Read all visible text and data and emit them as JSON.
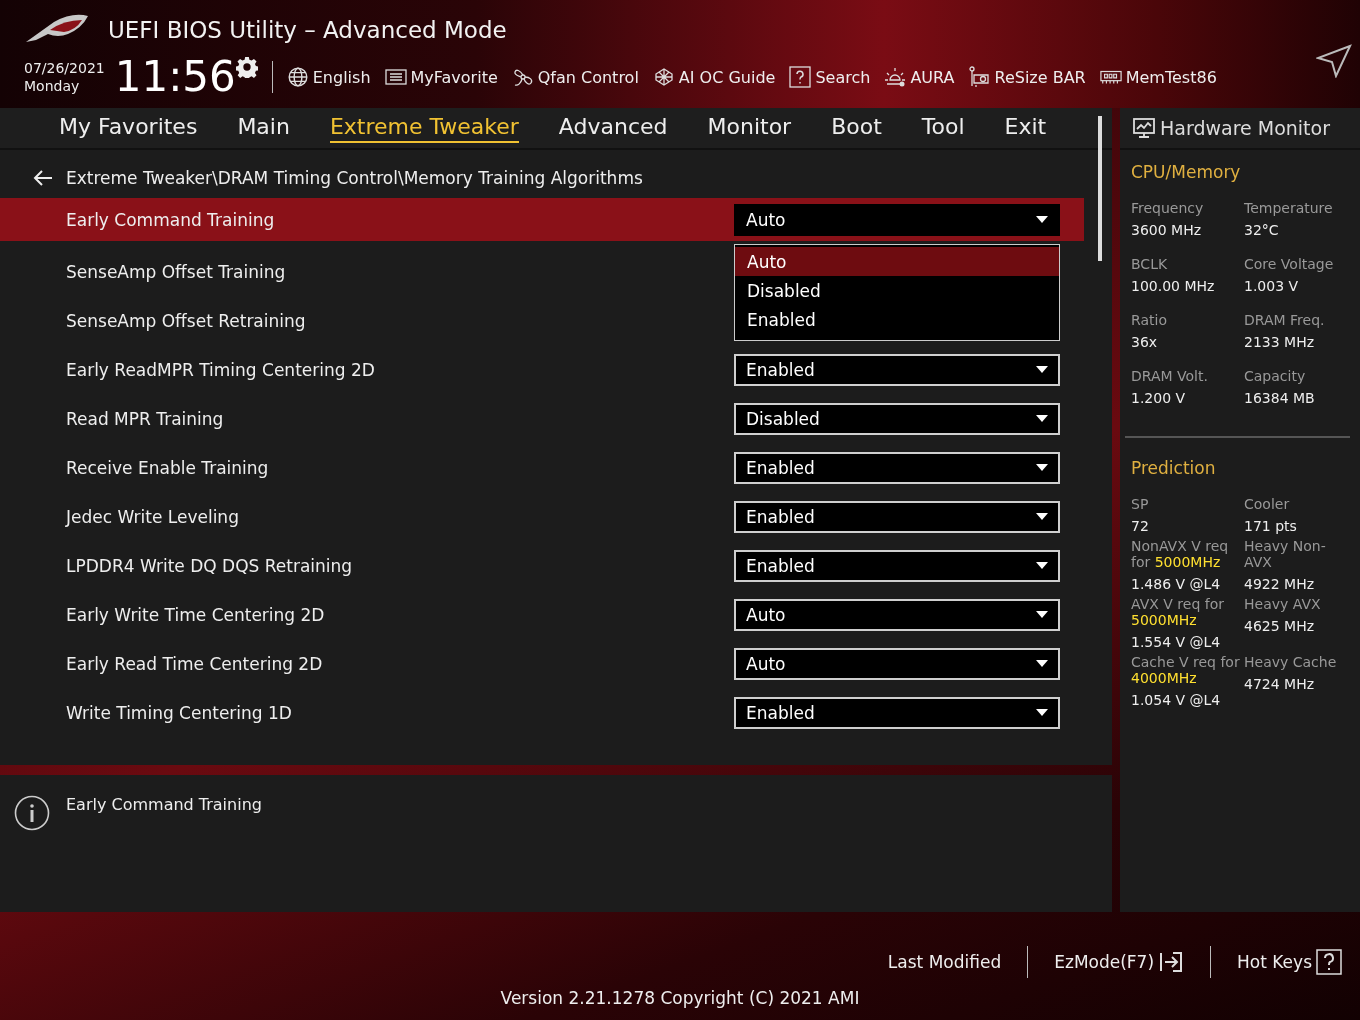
{
  "header": {
    "title": "UEFI BIOS Utility – Advanced Mode",
    "date": "07/26/2021",
    "day": "Monday",
    "time": "11:56",
    "tools": [
      {
        "label": "English"
      },
      {
        "label": "MyFavorite"
      },
      {
        "label": "Qfan Control"
      },
      {
        "label": "AI OC Guide"
      },
      {
        "label": "Search"
      },
      {
        "label": "AURA"
      },
      {
        "label": "ReSize BAR"
      },
      {
        "label": "MemTest86"
      }
    ]
  },
  "tabs": [
    {
      "label": "My Favorites",
      "selected": false
    },
    {
      "label": "Main",
      "selected": false
    },
    {
      "label": "Extreme Tweaker",
      "selected": true
    },
    {
      "label": "Advanced",
      "selected": false
    },
    {
      "label": "Monitor",
      "selected": false
    },
    {
      "label": "Boot",
      "selected": false
    },
    {
      "label": "Tool",
      "selected": false
    },
    {
      "label": "Exit",
      "selected": false
    }
  ],
  "breadcrumb": "Extreme Tweaker\\DRAM Timing Control\\Memory Training Algorithms",
  "settings": [
    {
      "label": "Early Command Training",
      "value": "Auto",
      "selected": true
    },
    {
      "label": "SenseAmp Offset Training",
      "selected": false
    },
    {
      "label": "SenseAmp Offset Retraining",
      "selected": false
    },
    {
      "label": "Early ReadMPR Timing Centering 2D",
      "value": "Enabled",
      "selected": false
    },
    {
      "label": "Read MPR Training",
      "value": "Disabled",
      "selected": false
    },
    {
      "label": "Receive Enable Training",
      "value": "Enabled",
      "selected": false
    },
    {
      "label": "Jedec Write Leveling",
      "value": "Enabled",
      "selected": false
    },
    {
      "label": "LPDDR4 Write DQ DQS Retraining",
      "value": "Enabled",
      "selected": false
    },
    {
      "label": "Early Write Time Centering 2D",
      "value": "Auto",
      "selected": false
    },
    {
      "label": "Early Read Time Centering 2D",
      "value": "Auto",
      "selected": false
    },
    {
      "label": "Write Timing Centering 1D",
      "value": "Enabled",
      "selected": false
    }
  ],
  "dropdown": {
    "options": [
      {
        "label": "Auto",
        "selected": true
      },
      {
        "label": "Disabled",
        "selected": false
      },
      {
        "label": "Enabled",
        "selected": false
      }
    ]
  },
  "help": {
    "text": "Early Command Training"
  },
  "hardware_monitor": {
    "title": "Hardware Monitor",
    "cpu_memory": {
      "title": "CPU/Memory",
      "items": [
        {
          "label": "Frequency",
          "value": "3600 MHz"
        },
        {
          "label": "Temperature",
          "value": "32°C"
        },
        {
          "label": "BCLK",
          "value": "100.00 MHz"
        },
        {
          "label": "Core Voltage",
          "value": "1.003 V"
        },
        {
          "label": "Ratio",
          "value": "36x"
        },
        {
          "label": "DRAM Freq.",
          "value": "2133 MHz"
        },
        {
          "label": "DRAM Volt.",
          "value": "1.200 V"
        },
        {
          "label": "Capacity",
          "value": "16384 MB"
        }
      ]
    },
    "prediction": {
      "title": "Prediction",
      "items": [
        {
          "label": "SP",
          "value": "72"
        },
        {
          "label": "Cooler",
          "value": "171 pts"
        },
        {
          "label": "NonAVX V req for",
          "highlight": "5000MHz",
          "value": "1.486 V @L4"
        },
        {
          "label": "Heavy Non-AVX",
          "value": "4922 MHz"
        },
        {
          "label": "AVX V req for",
          "highlight": "5000MHz",
          "value": "1.554 V @L4"
        },
        {
          "label": "Heavy AVX",
          "value": "4625 MHz"
        },
        {
          "label": "Cache V req for",
          "highlight": "4000MHz",
          "value": "1.054 V @L4"
        },
        {
          "label": "Heavy Cache",
          "value": "4724 MHz"
        }
      ]
    }
  },
  "footer": {
    "actions": [
      {
        "label": "Last Modified"
      },
      {
        "label": "EzMode(F7)"
      },
      {
        "label": "Hot Keys"
      }
    ],
    "version": "Version 2.21.1278 Copyright (C) 2021 AMI"
  }
}
